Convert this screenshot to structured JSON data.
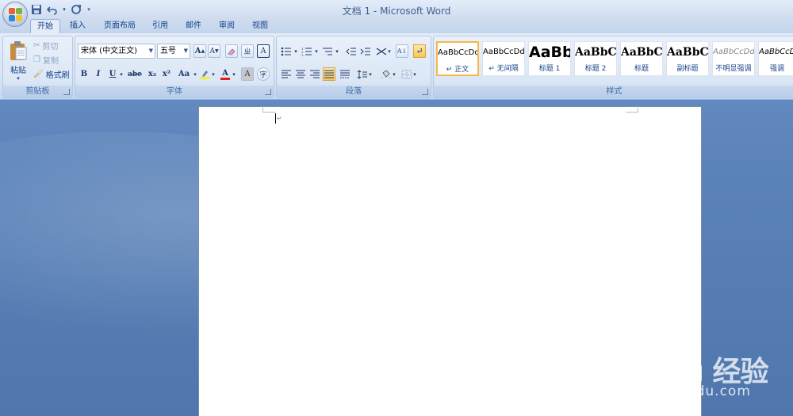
{
  "window": {
    "title": "文档 1 - Microsoft Word"
  },
  "quick_access": {
    "save_icon": "save-icon",
    "undo_icon": "undo-icon",
    "redo_icon": "redo-icon",
    "customize_icon": "qat-dropdown-icon"
  },
  "tabs": [
    {
      "label": "开始",
      "active": true
    },
    {
      "label": "插入"
    },
    {
      "label": "页面布局"
    },
    {
      "label": "引用"
    },
    {
      "label": "邮件"
    },
    {
      "label": "审阅"
    },
    {
      "label": "视图"
    }
  ],
  "clipboard": {
    "group_label": "剪贴板",
    "paste_label": "粘贴",
    "cut_label": "剪切",
    "copy_label": "复制",
    "format_painter_label": "格式刷"
  },
  "font": {
    "group_label": "字体",
    "font_name": "宋体 (中文正文)",
    "font_size": "五号",
    "bold": "B",
    "italic": "I",
    "underline": "U",
    "strikethrough": "abe",
    "subscript": "x₂",
    "superscript": "x²",
    "change_case": "Aa",
    "grow": "A",
    "shrink": "A",
    "phonetic": "ㄓ",
    "border_char": "A",
    "enclose": "字"
  },
  "paragraph": {
    "group_label": "段落"
  },
  "styles": {
    "group_label": "样式",
    "items": [
      {
        "sample": "AaBbCcDd",
        "name": "↵ 正文",
        "selected": true
      },
      {
        "sample": "AaBbCcDd",
        "name": "↵ 无间隔"
      },
      {
        "sample": "AaBb",
        "name": "标题 1"
      },
      {
        "sample": "AaBbC",
        "name": "标题 2"
      },
      {
        "sample": "AaBbC",
        "name": "标题"
      },
      {
        "sample": "AaBbC",
        "name": "副标题"
      },
      {
        "sample": "AaBbCcDd",
        "name": "不明显强调"
      },
      {
        "sample": "AaBbCcDd",
        "name": "强调"
      }
    ]
  },
  "watermark": {
    "brand": "Bai du 经验",
    "url": "jingyan.baidu.com"
  }
}
